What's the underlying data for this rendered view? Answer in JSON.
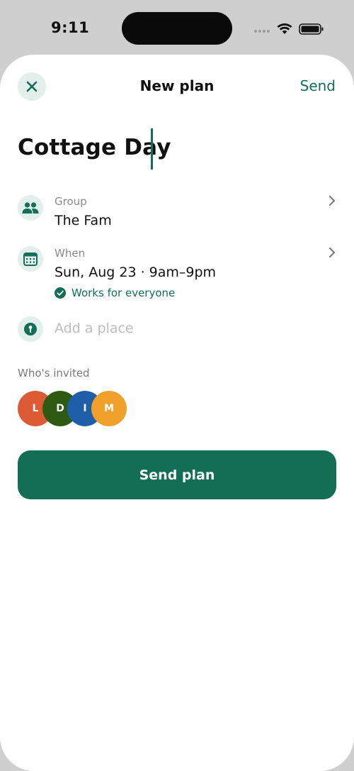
{
  "status_bar": {
    "time": "9:11"
  },
  "nav": {
    "title": "New plan",
    "send_label": "Send"
  },
  "plan": {
    "title": "Cottage Day"
  },
  "group": {
    "label": "Group",
    "value": "The Fam"
  },
  "when": {
    "label": "When",
    "value": "Sun, Aug 23 · 9am–9pm",
    "status": "Works for everyone"
  },
  "place": {
    "placeholder": "Add a place"
  },
  "invited": {
    "label": "Who's invited",
    "people": [
      {
        "initial": "L",
        "color": "#dc5b35"
      },
      {
        "initial": "D",
        "color": "#2f5a12"
      },
      {
        "initial": "I",
        "color": "#1f5ea8"
      },
      {
        "initial": "M",
        "color": "#efa12c"
      }
    ]
  },
  "actions": {
    "send_plan_label": "Send plan"
  },
  "colors": {
    "accent": "#126e55",
    "icon_bg": "#e3efeb"
  }
}
